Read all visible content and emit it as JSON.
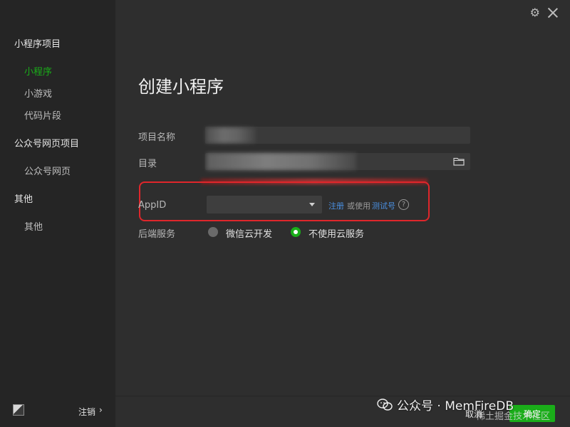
{
  "sidebar": {
    "groups": [
      {
        "label": "小程序项目",
        "items": [
          {
            "label": "小程序",
            "active": true
          },
          {
            "label": "小游戏"
          },
          {
            "label": "代码片段"
          }
        ]
      },
      {
        "label": "公众号网页项目",
        "items": [
          {
            "label": "公众号网页"
          }
        ]
      },
      {
        "label": "其他",
        "items": [
          {
            "label": "其他"
          }
        ]
      }
    ],
    "logout_label": "注销",
    "logout_chevron": "›"
  },
  "header": {
    "title": "创建小程序"
  },
  "form": {
    "project_name_label": "项目名称",
    "directory_label": "目录",
    "appid_label": "AppID",
    "register_link": "注册",
    "or_use_text": "或使用",
    "test_account_link": "测试号",
    "help_symbol": "?",
    "backend_label": "后端服务",
    "backend_options": [
      {
        "label": "微信云开发",
        "selected": false
      },
      {
        "label": "不使用云服务",
        "selected": true
      }
    ]
  },
  "footer": {
    "cancel_label": "取消",
    "confirm_label": "确定"
  },
  "watermark": {
    "text": "公众号 · MemFireDB",
    "text2": "稀土掘金技术社区"
  },
  "icons": {
    "settings": "gear-icon",
    "close": "close-icon",
    "folder": "folder-icon",
    "help": "help-icon"
  },
  "colors": {
    "accent": "#1aad19",
    "link": "#4a90e2",
    "highlight_box": "#e0262b"
  }
}
